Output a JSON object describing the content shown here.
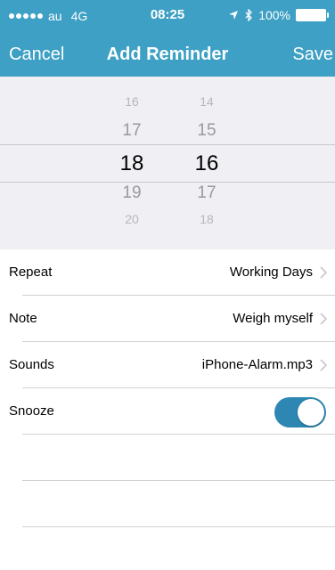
{
  "status_bar": {
    "carrier": "au",
    "network": "4G",
    "time": "08:25",
    "battery": "100%"
  },
  "nav": {
    "cancel": "Cancel",
    "title": "Add Reminder",
    "save": "Save"
  },
  "picker": {
    "hours": [
      "16",
      "17",
      "18",
      "19",
      "20"
    ],
    "minutes": [
      "14",
      "15",
      "16",
      "17",
      "18"
    ],
    "selected_hour": "18",
    "selected_minute": "16"
  },
  "settings": [
    {
      "label": "Repeat",
      "value": "Working Days"
    },
    {
      "label": "Note",
      "value": "Weigh myself"
    },
    {
      "label": "Sounds",
      "value": "iPhone-Alarm.mp3"
    },
    {
      "label": "Snooze",
      "toggle": true
    }
  ],
  "colors": {
    "header": "#3da0c4",
    "toggle_on": "#2e87b3",
    "picker_bg": "#efeff4"
  }
}
